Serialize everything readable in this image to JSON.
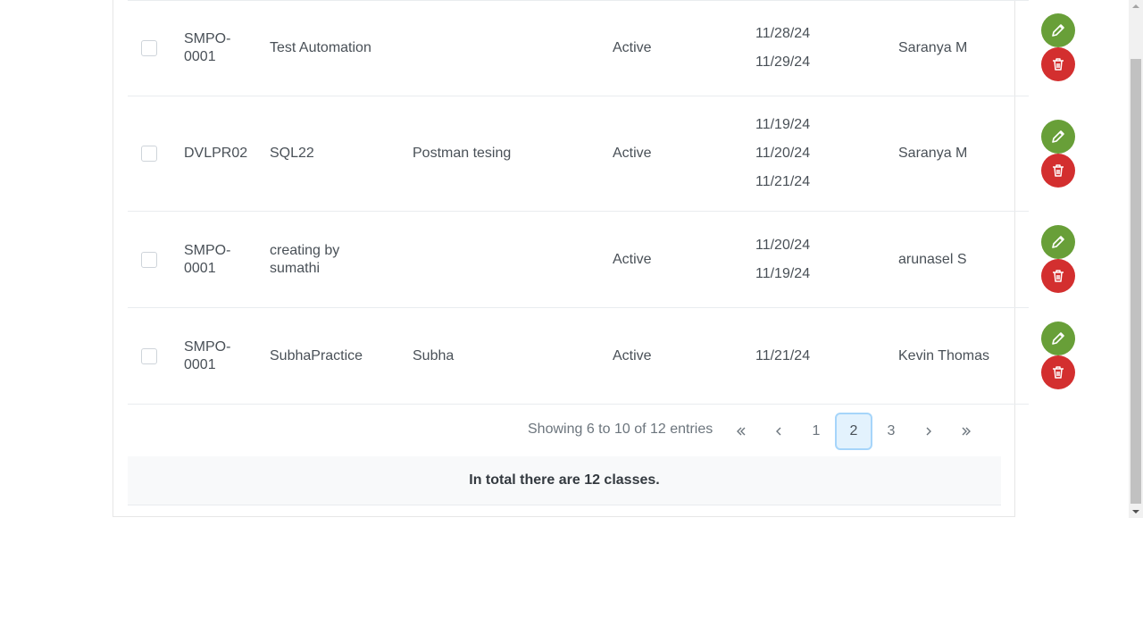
{
  "table": {
    "rows": [
      {
        "code": "SMPO-\n0001",
        "name": "Test Automation",
        "description": "",
        "status": "Active",
        "dates": [
          "11/28/24",
          "11/29/24"
        ],
        "owner": "Saranya M"
      },
      {
        "code": "DVLPR02",
        "name": "SQL22",
        "description": "Postman tesing",
        "status": "Active",
        "dates": [
          "11/19/24",
          "11/20/24",
          "11/21/24"
        ],
        "owner": "Saranya M"
      },
      {
        "code": "SMPO-\n0001",
        "name": "creating by\nsumathi",
        "description": "",
        "status": "Active",
        "dates": [
          "11/20/24",
          "11/19/24"
        ],
        "owner": "arunasel S"
      },
      {
        "code": "SMPO-\n0001",
        "name": "SubhaPractice",
        "description": "Subha",
        "status": "Active",
        "dates": [
          "11/21/24"
        ],
        "owner": "Kevin Thomas"
      }
    ]
  },
  "paginator": {
    "report": "Showing 6 to 10 of 12 entries",
    "pages": [
      "1",
      "2",
      "3"
    ],
    "current_page": "2"
  },
  "footer": {
    "summary": "In total there are 12 classes."
  },
  "colors": {
    "edit_button": "#689f38",
    "delete_button": "#d32f2f",
    "active_page_bg": "#e3f2fd",
    "active_page_border": "#a6d5fa"
  },
  "icons": {
    "edit": "pencil-icon",
    "delete": "trash-icon",
    "first": "double-chevron-left-icon",
    "prev": "chevron-left-icon",
    "next": "chevron-right-icon",
    "last": "double-chevron-right-icon"
  }
}
